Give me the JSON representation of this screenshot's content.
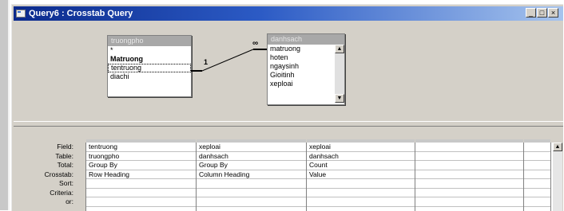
{
  "window": {
    "title": "Query6 : Crosstab Query"
  },
  "tables": [
    {
      "name": "truongpho",
      "fields": [
        "*",
        "Matruong",
        "tentruong",
        "diachi"
      ],
      "bold_index": 1,
      "selected_index": 2
    },
    {
      "name": "danhsach",
      "fields": [
        "matruong",
        "hoten",
        "ngaysinh",
        "Gioitinh",
        "xeploai"
      ]
    }
  ],
  "relationship": {
    "one_label": "1",
    "many_label": "∞"
  },
  "design_grid": {
    "row_labels": [
      "Field:",
      "Table:",
      "Total:",
      "Crosstab:",
      "Sort:",
      "Criteria:",
      "or:"
    ],
    "columns": [
      [
        "tentruong",
        "truongpho",
        "Group By",
        "Row Heading",
        "",
        "",
        ""
      ],
      [
        "xeploai",
        "danhsach",
        "Group By",
        "Column Heading",
        "",
        "",
        ""
      ],
      [
        "xeploai",
        "danhsach",
        "Count",
        "Value",
        "",
        "",
        ""
      ],
      [
        "",
        "",
        "",
        "",
        "",
        "",
        ""
      ],
      [
        "",
        "",
        "",
        "",
        "",
        "",
        ""
      ]
    ]
  }
}
